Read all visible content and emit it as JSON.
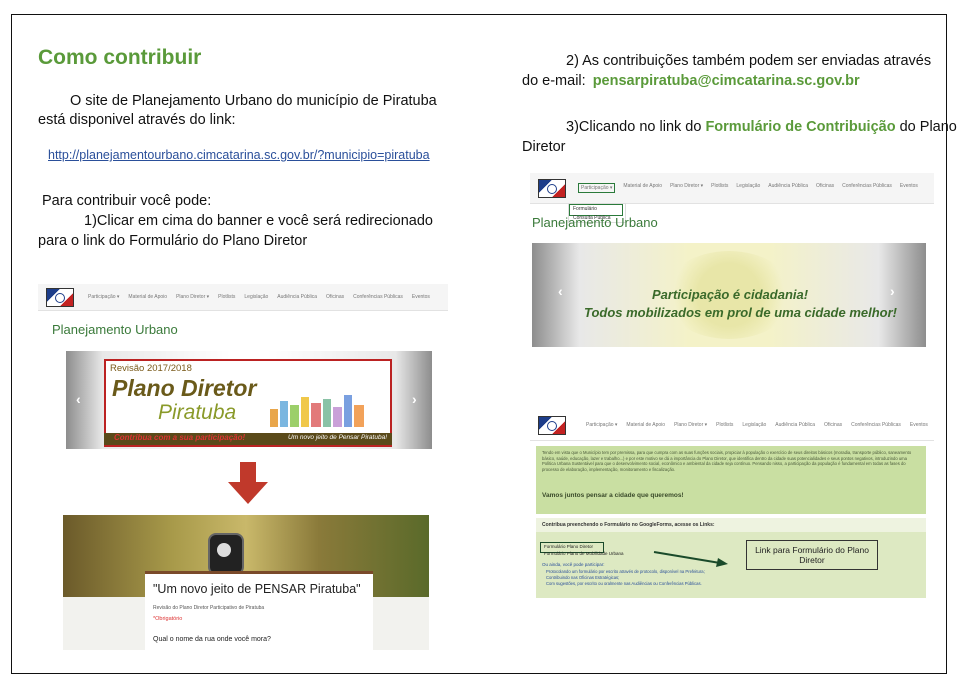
{
  "left": {
    "title": "Como contribuir",
    "intro_line1": "O site de Planejamento Urbano do município de Piratuba",
    "intro_line2": "está disponivel através do link:",
    "link": "http://planejamentourbano.cimcatarina.sc.gov.br/?municipio=piratuba",
    "contribute_heading": "Para contribuir você pode:",
    "step1_line1": "1)Clicar em cima do banner e você será redirecionado",
    "step1_line2": "para o link do Formulário do Plano Diretor"
  },
  "right": {
    "step2_line1": "2) As contribuições também podem ser enviadas através",
    "step2_prefix": "do e-mail:",
    "email": "pensarpiratuba@cimcatarina.sc.gov.br",
    "step3_prefix": "3)Clicando  no link do",
    "step3_link": "Formulário de Contribuição",
    "step3_suffix": "do Plano",
    "step3_line2": "Diretor"
  },
  "nav": {
    "items": [
      "Participação ▾",
      "Material de Apoio",
      "Plano Diretor ▾",
      "Plotlists",
      "Legislação",
      "Audiência Pública",
      "Oficinas",
      "Conferências Públicas",
      "Eventos"
    ],
    "dropdown_item1": "Formulário",
    "dropdown_item2": "Consulta Pública"
  },
  "site": {
    "heading": "Planejamento Urbano"
  },
  "banner1": {
    "revisao": "Revisão 2017/2018",
    "line1": "Plano Diretor",
    "line2": "Piratuba",
    "bottom_left": "Contribua com a sua participação!",
    "bottom_right": "Um novo jeito de Pensar Piratuba!"
  },
  "banner2": {
    "line1": "Participação é cidadania!",
    "line2": "Todos mobilizados em prol de uma cidade melhor!"
  },
  "form": {
    "title": "\"Um novo jeito de PENSAR Piratuba\"",
    "subtitle": "Revisão do Plano Diretor Participativo de Piratuba",
    "required": "*Obrigatório",
    "question": "Qual o nome da rua onde você mora?"
  },
  "page3": {
    "body_text": "Tendo em vista que o Município tem por premissa, para que cumpra com as suas funções sociais, propiciar à população o exercício de seus direitos básicos (moradia, transporte público, saneamento básico, saúde, educação, lazer e trabalho...) e por este motivo se dá a importância do Plano Diretor, que identifica dentro da cidade suas potencialidades e seus pontos negativos, introduzindo uma Política Urbana Sustentável para que o desenvolvimento social, econômico e ambiental da cidade seja contínuo. Pensando nisso, a participação da população é fundamental em todas as fases do processo de elaboração, implementação, monitoramento e fiscalização.",
    "bold": "Vamos juntos pensar a cidade que queremos!",
    "contribute_title": "Contribua preenchendo o Formulário no GoogleForms, acesse os Links:",
    "form_link1": "Formulário Plano Diretor",
    "form_link2": "Formulário Plano de Mobilidade Urbana",
    "also_title": "Ou ainda, você pode participar:",
    "bullets": [
      "Protocolando um formulário por escrito através de protocolo, disponível na Prefeitura;",
      "Contribuindo nas Oficinas Estratégicas;",
      "Com sugestões, por escrito ou oralmente nas Audiências ou Conferências Públicas."
    ],
    "callout": "Link para Formulário do Plano Diretor"
  },
  "colors": {
    "accent": "#5a9a3a",
    "link": "#2a4f9a",
    "arrow": "#c0392b"
  }
}
